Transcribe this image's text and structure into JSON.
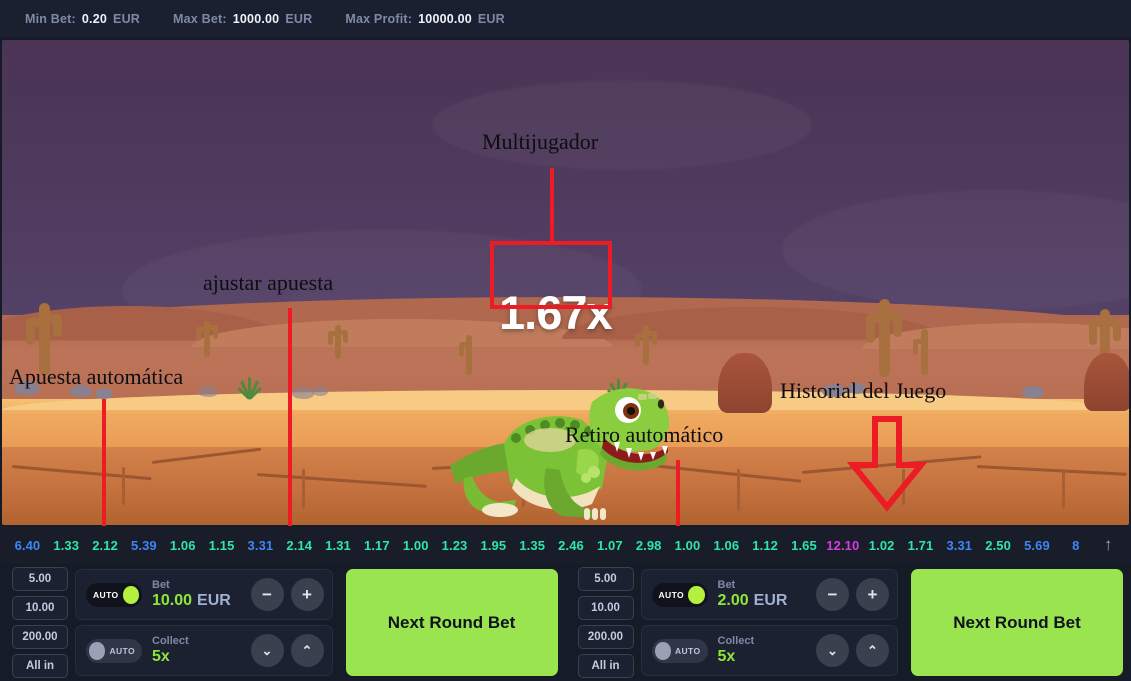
{
  "topbar": {
    "min_bet_label": "Min Bet:",
    "min_bet_value": "0.20",
    "max_bet_label": "Max Bet:",
    "max_bet_value": "1000.00",
    "max_profit_label": "Max Profit:",
    "max_profit_value": "10000.00",
    "currency": "EUR"
  },
  "game": {
    "multiplier": "1.67x"
  },
  "annotations": [
    {
      "id": "multijugador",
      "text": "Multijugador"
    },
    {
      "id": "ajustar-apuesta",
      "text": "ajustar apuesta"
    },
    {
      "id": "apuesta-automatica",
      "text": "Apuesta automática"
    },
    {
      "id": "retiro-automatico",
      "text": "Retiro automático"
    },
    {
      "id": "historial-del-juego",
      "text": "Historial del Juego"
    }
  ],
  "history": {
    "items": [
      {
        "value": "6.40",
        "color": "#3d86f5"
      },
      {
        "value": "1.33",
        "color": "#2ee6a8"
      },
      {
        "value": "2.12",
        "color": "#2ee6a8"
      },
      {
        "value": "5.39",
        "color": "#3d86f5"
      },
      {
        "value": "1.06",
        "color": "#2ee6a8"
      },
      {
        "value": "1.15",
        "color": "#2ee6a8"
      },
      {
        "value": "3.31",
        "color": "#3d86f5"
      },
      {
        "value": "2.14",
        "color": "#2ee6a8"
      },
      {
        "value": "1.31",
        "color": "#2ee6a8"
      },
      {
        "value": "1.17",
        "color": "#2ee6a8"
      },
      {
        "value": "1.00",
        "color": "#2ee6a8"
      },
      {
        "value": "1.23",
        "color": "#2ee6a8"
      },
      {
        "value": "1.95",
        "color": "#2ee6a8"
      },
      {
        "value": "1.35",
        "color": "#2ee6a8"
      },
      {
        "value": "2.46",
        "color": "#2ee6a8"
      },
      {
        "value": "1.07",
        "color": "#2ee6a8"
      },
      {
        "value": "2.98",
        "color": "#2ee6a8"
      },
      {
        "value": "1.00",
        "color": "#2ee6a8"
      },
      {
        "value": "1.06",
        "color": "#2ee6a8"
      },
      {
        "value": "1.12",
        "color": "#2ee6a8"
      },
      {
        "value": "1.65",
        "color": "#2ee6a8"
      },
      {
        "value": "12.10",
        "color": "#d63ce0"
      },
      {
        "value": "1.02",
        "color": "#2ee6a8"
      },
      {
        "value": "1.71",
        "color": "#2ee6a8"
      },
      {
        "value": "3.31",
        "color": "#3d86f5"
      },
      {
        "value": "2.50",
        "color": "#2ee6a8"
      },
      {
        "value": "5.69",
        "color": "#3d86f5"
      },
      {
        "value": "8",
        "color": "#3d86f5"
      }
    ],
    "expand_icon": "arrow-up-icon"
  },
  "panels": [
    {
      "id": "left",
      "quick_amounts": [
        "5.00",
        "10.00",
        "200.00",
        "All in"
      ],
      "bet": {
        "auto_label": "AUTO",
        "auto_on": true,
        "label": "Bet",
        "value": "10.00",
        "unit": "EUR",
        "minus": "−",
        "plus": "+"
      },
      "collect": {
        "auto_label": "AUTO",
        "auto_on": false,
        "label": "Collect",
        "value": "5x",
        "down": "⌄",
        "up": "⌃"
      },
      "action_label": "Next Round Bet"
    },
    {
      "id": "right",
      "quick_amounts": [
        "5.00",
        "10.00",
        "200.00",
        "All in"
      ],
      "bet": {
        "auto_label": "AUTO",
        "auto_on": true,
        "label": "Bet",
        "value": "2.00",
        "unit": "EUR",
        "minus": "−",
        "plus": "+"
      },
      "collect": {
        "auto_label": "AUTO",
        "auto_on": false,
        "label": "Collect",
        "value": "5x",
        "down": "⌄",
        "up": "⌃"
      },
      "action_label": "Next Round Bet"
    }
  ],
  "colors": {
    "accent_green": "#9ae54f",
    "value_green": "#8fe63a",
    "annotation_red": "#ed1c24",
    "panel_bg": "#1b2130"
  }
}
